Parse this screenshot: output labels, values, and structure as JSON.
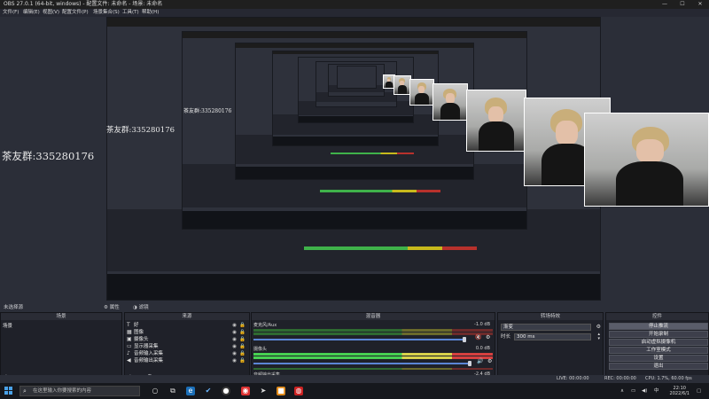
{
  "window": {
    "title": "OBS 27.0.1 (64-bit, windows) - 配置文件: 未命名 - 场景: 未命名",
    "minimize_icon": "minimize-icon",
    "maximize_icon": "maximize-icon",
    "close_icon": "close-icon"
  },
  "menu": [
    "文件(F)",
    "编辑(E)",
    "视图(V)",
    "配置文件(P)",
    "场景集合(S)",
    "工具(T)",
    "帮助(H)"
  ],
  "preview": {
    "overlay_text": "茶友群:335280176",
    "colors": {
      "background": "#2b2e38",
      "meter_green": "#47d052",
      "meter_yellow": "#d8d24b",
      "meter_red": "#d64040"
    }
  },
  "dock": {
    "scene_name": "未选择源",
    "properties_label": "属性",
    "filters_label": "滤镜"
  },
  "scenes": {
    "header": "场景",
    "items": [
      "场景"
    ]
  },
  "sources": {
    "header": "来源",
    "items": [
      {
        "label": "好",
        "icon": "text-icon"
      },
      {
        "label": "图像",
        "icon": "image-icon"
      },
      {
        "label": "摄像头",
        "icon": "camera-icon"
      },
      {
        "label": "显示器采集",
        "icon": "monitor-icon"
      },
      {
        "label": "音频输入采集",
        "icon": "microphone-icon"
      },
      {
        "label": "音频输出采集",
        "icon": "speaker-icon"
      }
    ]
  },
  "mixer": {
    "header": "混音器",
    "channels": [
      {
        "name": "麦克风/Aux",
        "db": "-1.0 dB",
        "muted": true,
        "level": 0.98
      },
      {
        "name": "摄像头",
        "db": "0.0 dB",
        "muted": false,
        "level": 1.0
      },
      {
        "name": "音频输出采集",
        "db": "-2.4 dB",
        "muted": false,
        "level": 0.9
      }
    ]
  },
  "transitions": {
    "header": "转场特效",
    "type": "渐变",
    "duration_label": "时长",
    "duration_value": "300 ms"
  },
  "controls": {
    "header": "控件",
    "buttons": [
      "停止推流",
      "开始录制",
      "启动虚拟摄像机",
      "工作室模式",
      "设置",
      "退出"
    ]
  },
  "status": {
    "live": "LIVE: 00:00:00",
    "rec": "REC: 00:00:00",
    "cpu": "CPU: 1.7%, 60.00 fps"
  },
  "taskbar": {
    "search_placeholder": "在这里输入你要搜索的内容",
    "time": "22:10",
    "date": "2022/6/1"
  }
}
